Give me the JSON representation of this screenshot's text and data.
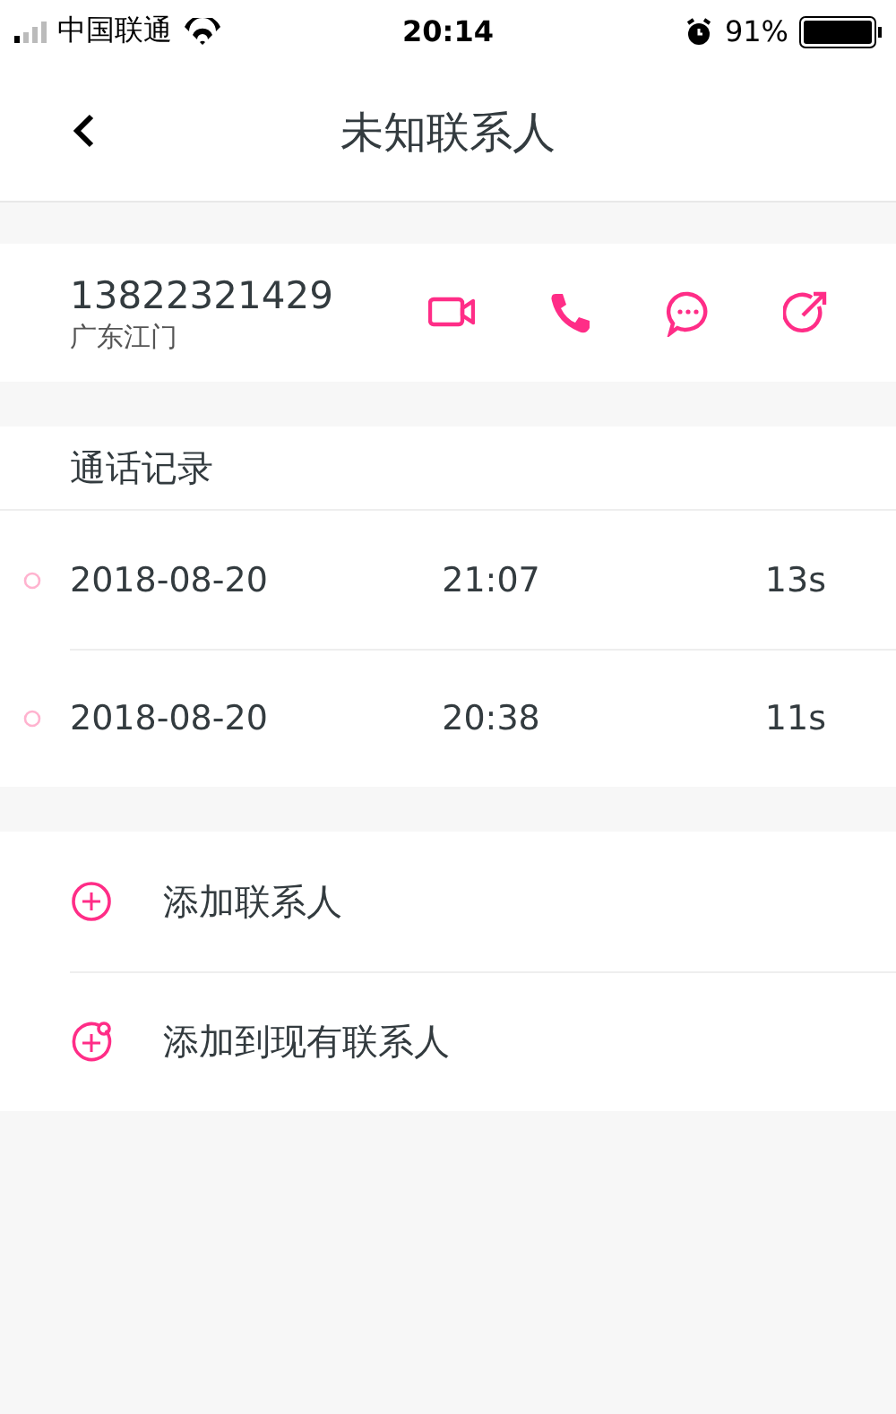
{
  "status_bar": {
    "carrier": "中国联通",
    "time": "20:14",
    "battery": "91%"
  },
  "nav": {
    "title": "未知联系人"
  },
  "contact": {
    "number": "13822321429",
    "location": "广东江门",
    "actions": [
      {
        "kind": "video"
      },
      {
        "kind": "call"
      },
      {
        "kind": "message"
      },
      {
        "kind": "share"
      }
    ]
  },
  "call_log": {
    "title": "通话记录",
    "rows": [
      {
        "date": "2018-08-20",
        "time": "21:07",
        "duration": "13s"
      },
      {
        "date": "2018-08-20",
        "time": "20:38",
        "duration": "11s"
      }
    ]
  },
  "actions": [
    {
      "kind": "add",
      "label": "添加联系人"
    },
    {
      "kind": "add-existing",
      "label": "添加到现有联系人"
    }
  ]
}
